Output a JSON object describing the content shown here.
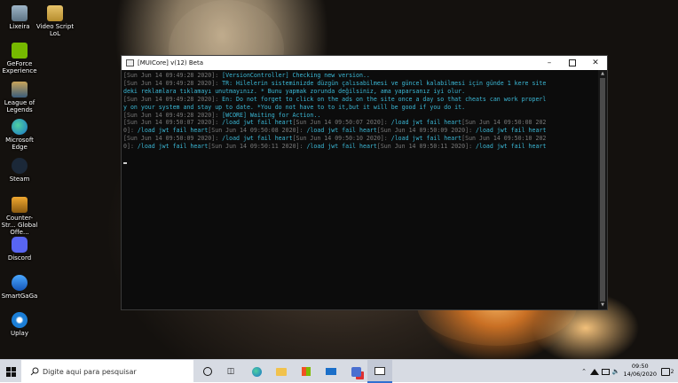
{
  "desktop_icons": [
    {
      "label": "Lixeira",
      "icon": "recycle-bin-icon"
    },
    {
      "label": "Video Script LoL",
      "icon": "folder-icon"
    },
    {
      "label": "GeForce Experience",
      "icon": "geforce-icon"
    },
    {
      "label": "League of Legends",
      "icon": "league-icon"
    },
    {
      "label": "Microsoft Edge",
      "icon": "edge-icon"
    },
    {
      "label": "Steam",
      "icon": "steam-icon"
    },
    {
      "label": "Counter-Str... Global Offe...",
      "icon": "csgo-icon"
    },
    {
      "label": "Discord",
      "icon": "discord-icon"
    },
    {
      "label": "SmartGaGa",
      "icon": "smartgaga-icon"
    },
    {
      "label": "Uplay",
      "icon": "uplay-icon"
    }
  ],
  "window": {
    "title": "[MUICore] v(12) Beta",
    "lines": [
      [
        [
          "g",
          "[Sun Jun 14 09:49:28 2020]: "
        ],
        [
          "c",
          "[VersionController] Checking new version.."
        ]
      ],
      [
        [
          "g",
          "[Sun Jun 14 09:49:28 2020]: "
        ],
        [
          "c",
          "TR: Hilelerin sisteminizde düzgün çalısabilmesi ve güncel kalabilmesi için günde 1 kere site"
        ]
      ],
      [
        [
          "c",
          "deki reklamlara tıklamayı unutmayınız. * Bunu yapmak zorunda değilsiniz, ama yaparsanız iyi olur."
        ]
      ],
      [
        [
          "g",
          "[Sun Jun 14 09:49:28 2020]: "
        ],
        [
          "c",
          "En: Do not forget to click on the ads on the site once a day so that cheats can work properl"
        ]
      ],
      [
        [
          "c",
          "y on your system and stay up to date. *You do not have to to it,but it will be good if you do it."
        ]
      ],
      [
        [
          "g",
          "[Sun Jun 14 09:49:28 2020]: "
        ],
        [
          "c",
          "[WCORE] Waiting for Action.."
        ]
      ],
      [
        [
          "g",
          "[Sun Jun 14 09:50:07 2020]: "
        ],
        [
          "c",
          "/load jwt fail heart"
        ],
        [
          "g",
          "[Sun Jun 14 09:50:07 2020]: "
        ],
        [
          "c",
          "/load jwt fail heart"
        ],
        [
          "g",
          "[Sun Jun 14 09:50:08 202"
        ]
      ],
      [
        [
          "g",
          "0]: "
        ],
        [
          "c",
          "/load jwt fail heart"
        ],
        [
          "g",
          "[Sun Jun 14 09:50:08 2020]: "
        ],
        [
          "c",
          "/load jwt fail heart"
        ],
        [
          "g",
          "[Sun Jun 14 09:50:09 2020]: "
        ],
        [
          "c",
          "/load jwt fail heart"
        ]
      ],
      [
        [
          "g",
          "[Sun Jun 14 09:50:09 2020]: "
        ],
        [
          "c",
          "/load jwt fail heart"
        ],
        [
          "g",
          "[Sun Jun 14 09:50:10 2020]: "
        ],
        [
          "c",
          "/load jwt fail heart"
        ],
        [
          "g",
          "[Sun Jun 14 09:50:10 202"
        ]
      ],
      [
        [
          "g",
          "0]: "
        ],
        [
          "c",
          "/load jwt fail heart"
        ],
        [
          "g",
          "[Sun Jun 14 09:50:11 2020]: "
        ],
        [
          "c",
          "/load jwt fail heart"
        ],
        [
          "g",
          "[Sun Jun 14 09:50:11 2020]: "
        ],
        [
          "c",
          "/load jwt fail heart"
        ]
      ]
    ]
  },
  "taskbar": {
    "search_placeholder": "Digite aqui para pesquisar",
    "time": "09:50",
    "date": "14/06/2020",
    "notification_count": "2"
  },
  "colors": {
    "console_gray": "#7a7a7a",
    "console_cyan": "#3bb8d6",
    "taskbar_bg": "#d7dbe3"
  }
}
